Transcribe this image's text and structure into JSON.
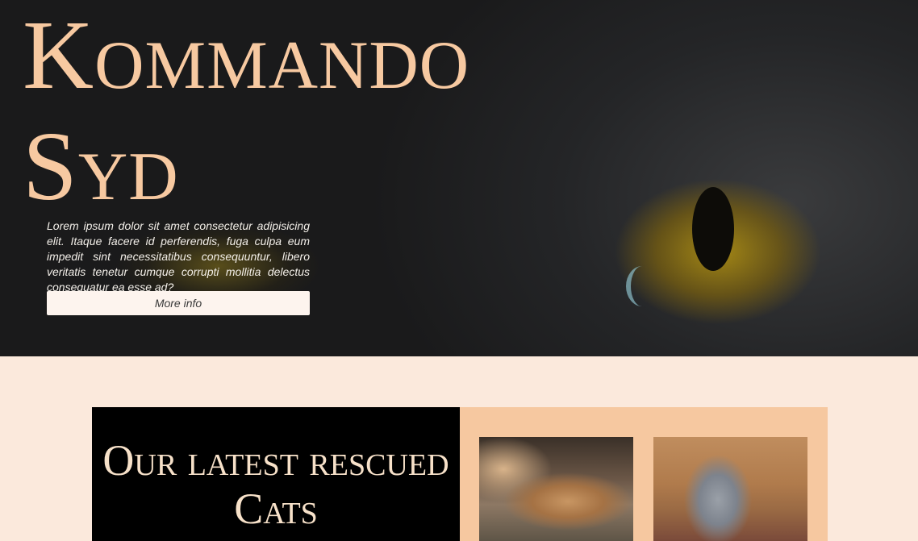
{
  "hero": {
    "title_line1": "Kommando",
    "title_line2": "Syd",
    "text": "Lorem ipsum dolor sit amet consectetur adipisicing elit. Itaque facere id perferendis, fuga culpa eum impedit sint necessitatibus consequuntur, libero veritatis tenetur cumque corrupti mollitia delectus consequatur ea esse ad?",
    "button_label": "More info",
    "title_color": "#f7c9a1"
  },
  "cats": {
    "heading": "Our latest rescued Cats",
    "panel_color": "#f6c8a0",
    "background_color": "#fbe9dc"
  }
}
